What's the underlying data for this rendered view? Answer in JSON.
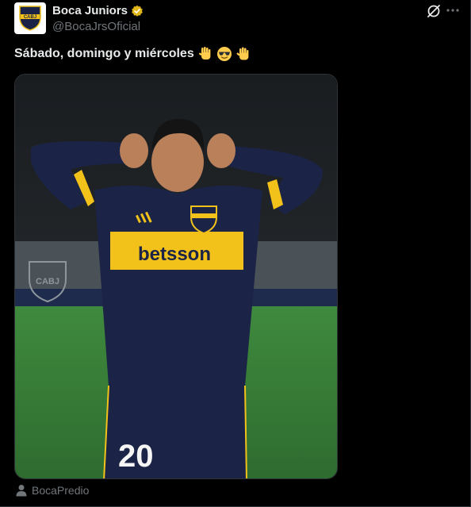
{
  "author": {
    "name": "Boca Juniors",
    "handle": "@BocaJrsOficial",
    "verified": true,
    "avatar_text": "CABJ"
  },
  "tweet": {
    "text": "Sábado, domingo y miércoles",
    "emojis": [
      "raised-hand-emoji",
      "sunglasses-emoji",
      "waving-hand-emoji"
    ]
  },
  "media": {
    "logo_text": "CABJ",
    "sponsor_text": "betsson",
    "shirt_number": "20"
  },
  "location": {
    "label": "BocaPredio"
  },
  "colors": {
    "background": "#000000",
    "text_primary": "#e7e9ea",
    "text_secondary": "#71767b",
    "verified_gold": "#e2b719",
    "boca_blue": "#1b2446",
    "boca_gold": "#f2c21b"
  }
}
